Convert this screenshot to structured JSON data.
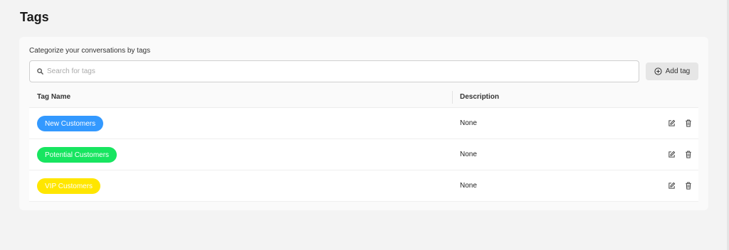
{
  "page": {
    "title": "Tags"
  },
  "card": {
    "subtitle": "Categorize your conversations by tags",
    "search": {
      "placeholder": "Search for tags",
      "value": "",
      "icon": "search-icon"
    },
    "add_button": {
      "label": "Add tag",
      "icon": "plus-circle-icon"
    }
  },
  "table": {
    "columns": [
      "Tag Name",
      "Description"
    ],
    "rows": [
      {
        "name": "New Customers",
        "color": "#3399ff",
        "description": "None"
      },
      {
        "name": "Potential Customers",
        "color": "#17e560",
        "description": "None"
      },
      {
        "name": "VIP Customers",
        "color": "#ffe600",
        "description": "None"
      }
    ],
    "row_actions": [
      "edit-icon",
      "trash-icon"
    ]
  }
}
